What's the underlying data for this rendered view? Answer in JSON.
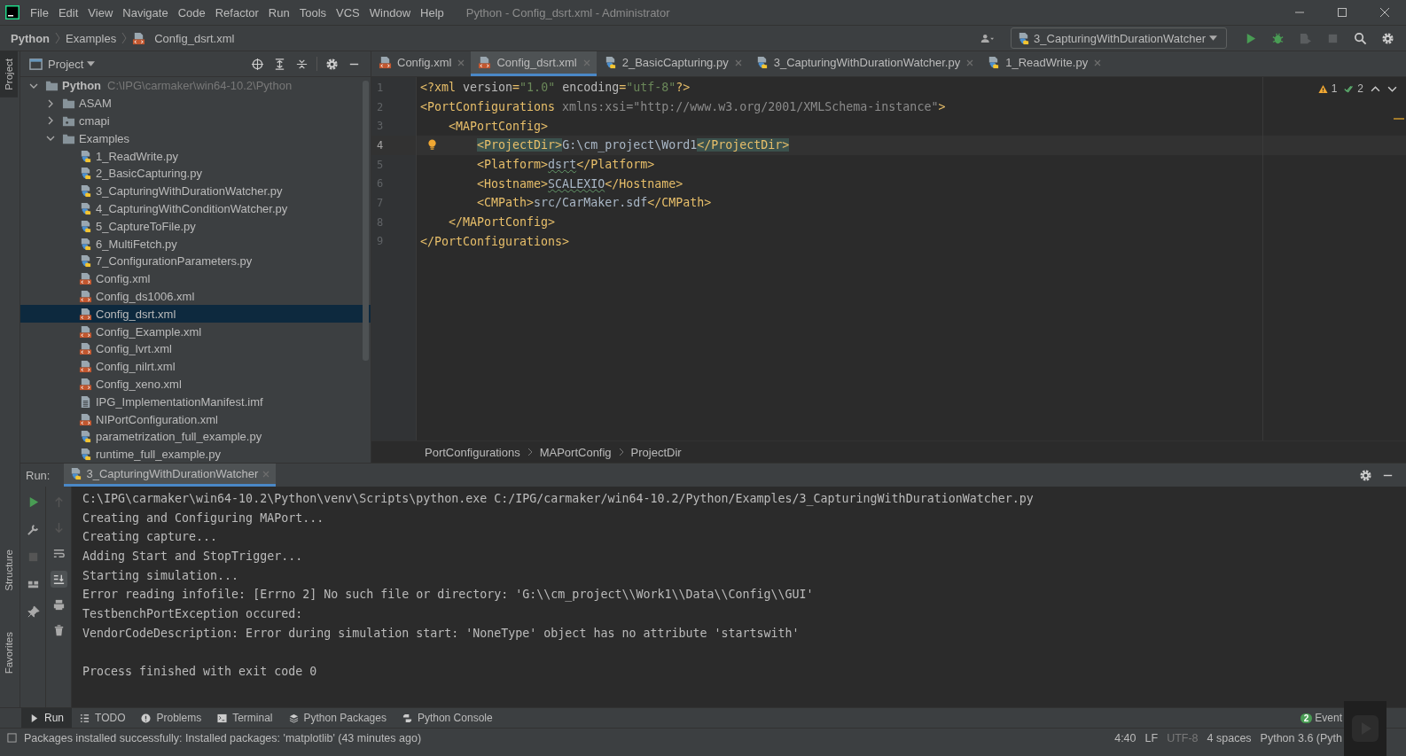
{
  "window": {
    "title": "Python - Config_dsrt.xml - Administrator"
  },
  "menu": [
    "File",
    "Edit",
    "View",
    "Navigate",
    "Code",
    "Refactor",
    "Run",
    "Tools",
    "VCS",
    "Window",
    "Help"
  ],
  "breadcrumb": [
    {
      "label": "Python",
      "kind": "project"
    },
    {
      "label": "Examples",
      "kind": "folder"
    },
    {
      "label": "Config_dsrt.xml",
      "kind": "xml"
    }
  ],
  "run_config": "3_CapturingWithDurationWatcher",
  "side_stripe": {
    "top": [
      {
        "label": "Project",
        "selected": true
      }
    ],
    "bottom": [
      {
        "label": "Structure",
        "selected": false
      },
      {
        "label": "Favorites",
        "selected": false
      }
    ]
  },
  "project_panel": {
    "title": "Project",
    "tree": [
      {
        "label": "Python",
        "path": "C:\\IPG\\carmaker\\win64-10.2\\Python",
        "kind": "folder",
        "expanded": true,
        "selected": false,
        "children": [
          {
            "label": "ASAM",
            "kind": "folder",
            "expanded": false,
            "selected": false
          },
          {
            "label": "cmapi",
            "kind": "package",
            "expanded": false,
            "selected": false
          },
          {
            "label": "Examples",
            "kind": "folder",
            "expanded": true,
            "selected": false,
            "children": [
              {
                "label": "1_ReadWrite.py",
                "kind": "py",
                "selected": false
              },
              {
                "label": "2_BasicCapturing.py",
                "kind": "py",
                "selected": false
              },
              {
                "label": "3_CapturingWithDurationWatcher.py",
                "kind": "py",
                "selected": false
              },
              {
                "label": "4_CapturingWithConditionWatcher.py",
                "kind": "py",
                "selected": false
              },
              {
                "label": "5_CaptureToFile.py",
                "kind": "py",
                "selected": false
              },
              {
                "label": "6_MultiFetch.py",
                "kind": "py",
                "selected": false
              },
              {
                "label": "7_ConfigurationParameters.py",
                "kind": "py",
                "selected": false
              },
              {
                "label": "Config.xml",
                "kind": "xml",
                "selected": false
              },
              {
                "label": "Config_ds1006.xml",
                "kind": "xml",
                "selected": false
              },
              {
                "label": "Config_dsrt.xml",
                "kind": "xml",
                "selected": true
              },
              {
                "label": "Config_Example.xml",
                "kind": "xml",
                "selected": false
              },
              {
                "label": "Config_lvrt.xml",
                "kind": "xml",
                "selected": false
              },
              {
                "label": "Config_nilrt.xml",
                "kind": "xml",
                "selected": false
              },
              {
                "label": "Config_xeno.xml",
                "kind": "xml",
                "selected": false
              },
              {
                "label": "IPG_ImplementationManifest.imf",
                "kind": "text",
                "selected": false
              },
              {
                "label": "NIPortConfiguration.xml",
                "kind": "xml",
                "selected": false
              },
              {
                "label": "parametrization_full_example.py",
                "kind": "py",
                "selected": false
              },
              {
                "label": "runtime_full_example.py",
                "kind": "py",
                "selected": false
              }
            ]
          }
        ]
      }
    ]
  },
  "editor_tabs": [
    {
      "label": "Config.xml",
      "kind": "xml",
      "selected": false
    },
    {
      "label": "Config_dsrt.xml",
      "kind": "xml",
      "selected": true
    },
    {
      "label": "2_BasicCapturing.py",
      "kind": "py",
      "selected": false
    },
    {
      "label": "3_CapturingWithDurationWatcher.py",
      "kind": "py",
      "selected": false
    },
    {
      "label": "1_ReadWrite.py",
      "kind": "py",
      "selected": false
    }
  ],
  "inspections": {
    "warnings": "1",
    "typos": "2"
  },
  "code": [
    {
      "number": "1",
      "current": false,
      "bulb": false,
      "segments": [
        {
          "kind": "tag",
          "text": "<?xml "
        },
        {
          "kind": "attr",
          "text": "version"
        },
        {
          "kind": "tag",
          "text": "="
        },
        {
          "kind": "string",
          "text": "\"1.0\""
        },
        {
          "kind": "attr",
          "text": " encoding"
        },
        {
          "kind": "tag",
          "text": "="
        },
        {
          "kind": "string",
          "text": "\"utf-8\""
        },
        {
          "kind": "tag",
          "text": "?>"
        }
      ]
    },
    {
      "number": "2",
      "current": false,
      "bulb": false,
      "segments": [
        {
          "kind": "tag",
          "text": "<PortConfigurations "
        },
        {
          "kind": "unused",
          "text": "xmlns:xsi=\"http://www.w3.org/2001/XMLSchema-instance\""
        },
        {
          "kind": "tag",
          "text": ">"
        }
      ]
    },
    {
      "number": "3",
      "current": false,
      "bulb": false,
      "segments": [
        {
          "kind": "tag",
          "text": "    <MAPortConfig>"
        }
      ]
    },
    {
      "number": "4",
      "current": true,
      "bulb": true,
      "segments": [
        {
          "kind": "tag",
          "text": "        <ProjectDir>",
          "matched": true
        },
        {
          "kind": "text",
          "text": "G:\\cm_project\\Word1"
        },
        {
          "kind": "tag",
          "text": "</ProjectDir>",
          "matched": true
        }
      ]
    },
    {
      "number": "5",
      "current": false,
      "bulb": false,
      "segments": [
        {
          "kind": "tag",
          "text": "        <Platform>"
        },
        {
          "kind": "text",
          "text": "dsrt",
          "typo": true
        },
        {
          "kind": "tag",
          "text": "</Platform>"
        }
      ]
    },
    {
      "number": "6",
      "current": false,
      "bulb": false,
      "segments": [
        {
          "kind": "tag",
          "text": "        <Hostname>"
        },
        {
          "kind": "text",
          "text": "SCALEXIO",
          "typo": true
        },
        {
          "kind": "tag",
          "text": "</Hostname>"
        }
      ]
    },
    {
      "number": "7",
      "current": false,
      "bulb": false,
      "segments": [
        {
          "kind": "tag",
          "text": "        <CMPath>"
        },
        {
          "kind": "text",
          "text": "src/CarMaker.sdf"
        },
        {
          "kind": "tag",
          "text": "</CMPath>"
        }
      ]
    },
    {
      "number": "8",
      "current": false,
      "bulb": false,
      "segments": [
        {
          "kind": "tag",
          "text": "    </MAPortConfig>"
        }
      ]
    },
    {
      "number": "9",
      "current": false,
      "bulb": false,
      "segments": [
        {
          "kind": "tag",
          "text": "</PortConfigurations>"
        }
      ]
    }
  ],
  "editor_breadcrumb": [
    "PortConfigurations",
    "MAPortConfig",
    "ProjectDir"
  ],
  "run_panel": {
    "label": "Run:",
    "tab": "3_CapturingWithDurationWatcher",
    "output": [
      "C:\\IPG\\carmaker\\win64-10.2\\Python\\venv\\Scripts\\python.exe C:/IPG/carmaker/win64-10.2/Python/Examples/3_CapturingWithDurationWatcher.py",
      "Creating and Configuring MAPort...",
      "Creating capture...",
      "Adding Start and StopTrigger...",
      "Starting simulation...",
      "Error reading infofile: [Errno 2] No such file or directory: 'G:\\\\cm_project\\\\Work1\\\\Data\\\\Config\\\\GUI'",
      "TestbenchPortException occured:",
      "VendorCodeDescription: Error during simulation start: 'NoneType' object has no attribute 'startswith'"
    ],
    "exit_message": "Process finished with exit code 0"
  },
  "tool_tabs": [
    {
      "label": "Run",
      "kind": "run",
      "selected": true
    },
    {
      "label": "TODO",
      "kind": "todo",
      "selected": false
    },
    {
      "label": "Problems",
      "kind": "problems",
      "selected": false
    },
    {
      "label": "Terminal",
      "kind": "terminal",
      "selected": false
    },
    {
      "label": "Python Packages",
      "kind": "packages",
      "selected": false
    },
    {
      "label": "Python Console",
      "kind": "console",
      "selected": false
    }
  ],
  "event_log": {
    "count": "2",
    "label": "Event"
  },
  "status_bar": {
    "message": "Packages installed successfully: Installed packages: 'matplotlib' (43 minutes ago)",
    "items": [
      {
        "text": "4:40",
        "dim": false
      },
      {
        "text": "LF",
        "dim": false
      },
      {
        "text": "UTF-8",
        "dim": true
      },
      {
        "text": "4 spaces",
        "dim": false
      },
      {
        "text": "Python 3.6 (Pyth",
        "dim": false
      }
    ]
  }
}
